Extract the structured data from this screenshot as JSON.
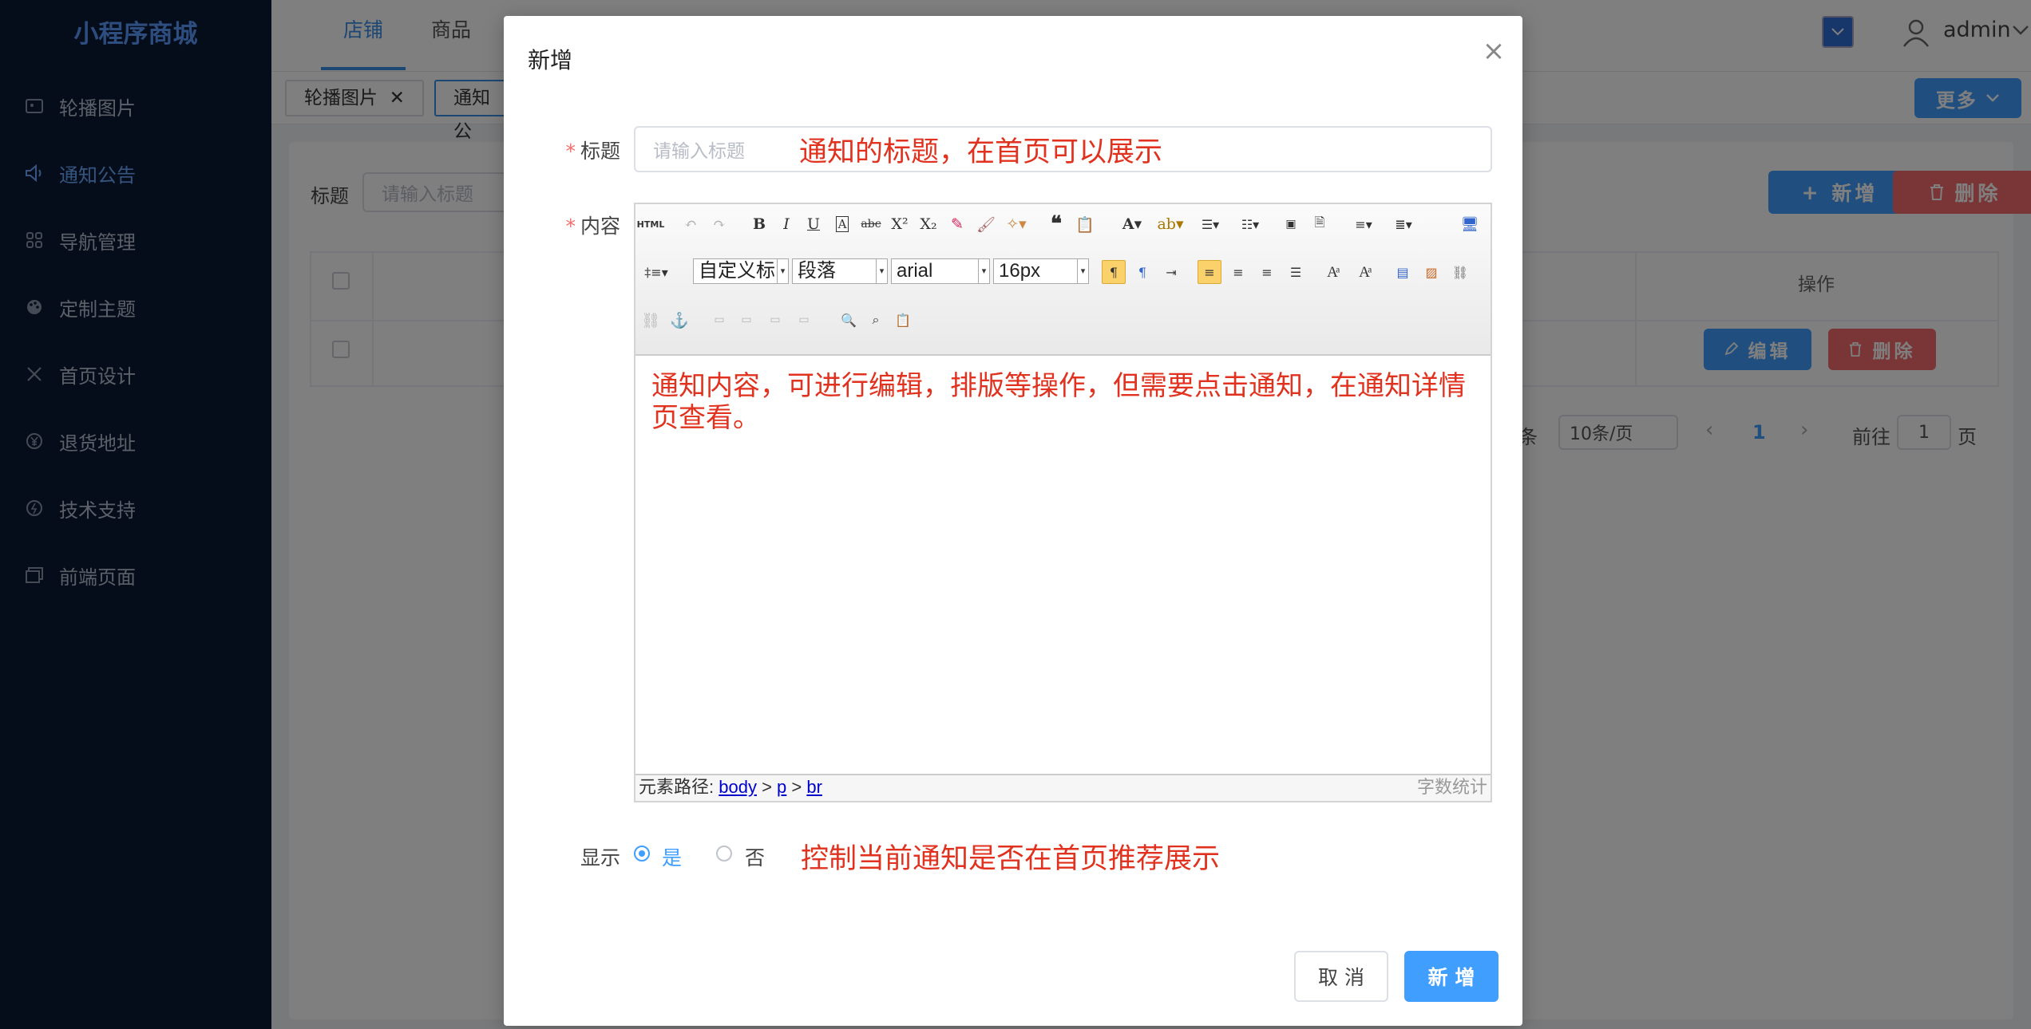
{
  "sidebar": {
    "brand": "小程序商城",
    "items": [
      {
        "label": "轮播图片",
        "icon": "image-icon"
      },
      {
        "label": "通知公告",
        "icon": "speaker-icon",
        "active": true
      },
      {
        "label": "导航管理",
        "icon": "grid-icon"
      },
      {
        "label": "定制主题",
        "icon": "palette-icon"
      },
      {
        "label": "首页设计",
        "icon": "tools-icon"
      },
      {
        "label": "退货地址",
        "icon": "yen-icon"
      },
      {
        "label": "技术支持",
        "icon": "support-icon"
      },
      {
        "label": "前端页面",
        "icon": "window-icon"
      }
    ]
  },
  "header": {
    "tabs": [
      "店铺",
      "商品"
    ],
    "user": "admin",
    "more_label": "更多"
  },
  "tags": [
    "轮播图片",
    "通知公"
  ],
  "search": {
    "label": "标题",
    "placeholder": "请输入标题"
  },
  "toolbar": {
    "add_label": "新增",
    "delete_label": "删除"
  },
  "table": {
    "op_header": "操作",
    "edit_label": "编辑",
    "delete_label": "删除"
  },
  "pagination": {
    "suffix": "条",
    "page_size": "10条/页",
    "current": "1",
    "goto_label": "前往",
    "goto_value": "1",
    "page_label": "页"
  },
  "dialog": {
    "title": "新增",
    "title_field": {
      "label": "标题",
      "placeholder": "请输入标题",
      "annotation": "通知的标题，在首页可以展示"
    },
    "content_field": {
      "label": "内容",
      "text": "通知内容，可进行编辑，排版等操作，但需要点击通知，在通知详情页查看。"
    },
    "editor": {
      "font_custom": "自定义标",
      "paragraph": "段落",
      "font_family": "arial",
      "font_size": "16px",
      "path_label": "元素路径:",
      "path": [
        "body",
        "p",
        "br"
      ],
      "word_count": "字数统计"
    },
    "show_field": {
      "label": "显示",
      "yes": "是",
      "no": "否",
      "annotation": "控制当前通知是否在首页推荐展示"
    },
    "cancel_label": "取 消",
    "submit_label": "新 增"
  },
  "colors": {
    "primary": "#409eff",
    "danger": "#f56c6c",
    "sidebar": "#0b1b35",
    "annotation": "#e0321e"
  }
}
